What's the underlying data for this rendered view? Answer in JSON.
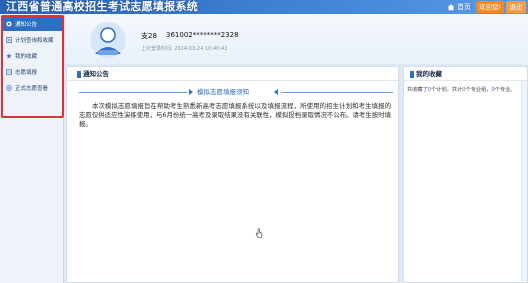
{
  "header": {
    "app_title": "江西省普通高校招生考试志愿填报系统",
    "home_label": "首页",
    "welcome_label": "欢迎您!",
    "exit_label": "退出"
  },
  "sidebar": {
    "items": [
      {
        "label": "通知公告",
        "icon": "bell-icon",
        "active": true
      },
      {
        "label": "计划查询和收藏",
        "icon": "search-doc-icon",
        "active": false
      },
      {
        "label": "我的收藏",
        "icon": "star-icon",
        "active": false
      },
      {
        "label": "志愿填报",
        "icon": "form-icon",
        "active": false
      },
      {
        "label": "正式志愿查看",
        "icon": "view-icon",
        "active": false
      }
    ]
  },
  "profile": {
    "name": "支28",
    "id_number": "361002********2328",
    "last_login": "上次登录时间: 2024-03-24 10:40:42"
  },
  "notice": {
    "section_title": "通知公告",
    "headline": "模拟志愿填报须知",
    "body": "本次模拟志愿填报旨在帮助考生熟悉新高考志愿填报系统以及填报流程，所使用的招生计划和考生填报的志愿仅供适应性演练使用，与6月份统一高考及录取结果没有关联性，模拟投档录取情况不公布。请考生按时填报。"
  },
  "favorites": {
    "section_title": "我的收藏",
    "summary_prefix": "共收藏了",
    "plan_count": "0",
    "summary_mid1": "个计划，共计",
    "major_count": "0",
    "summary_mid2": "个专业组，",
    "group_count": "0",
    "summary_suffix": "个专业。"
  },
  "colors": {
    "accent": "#2f6fc3",
    "highlight_frame": "#e23131",
    "welcome": "#f08a24"
  }
}
